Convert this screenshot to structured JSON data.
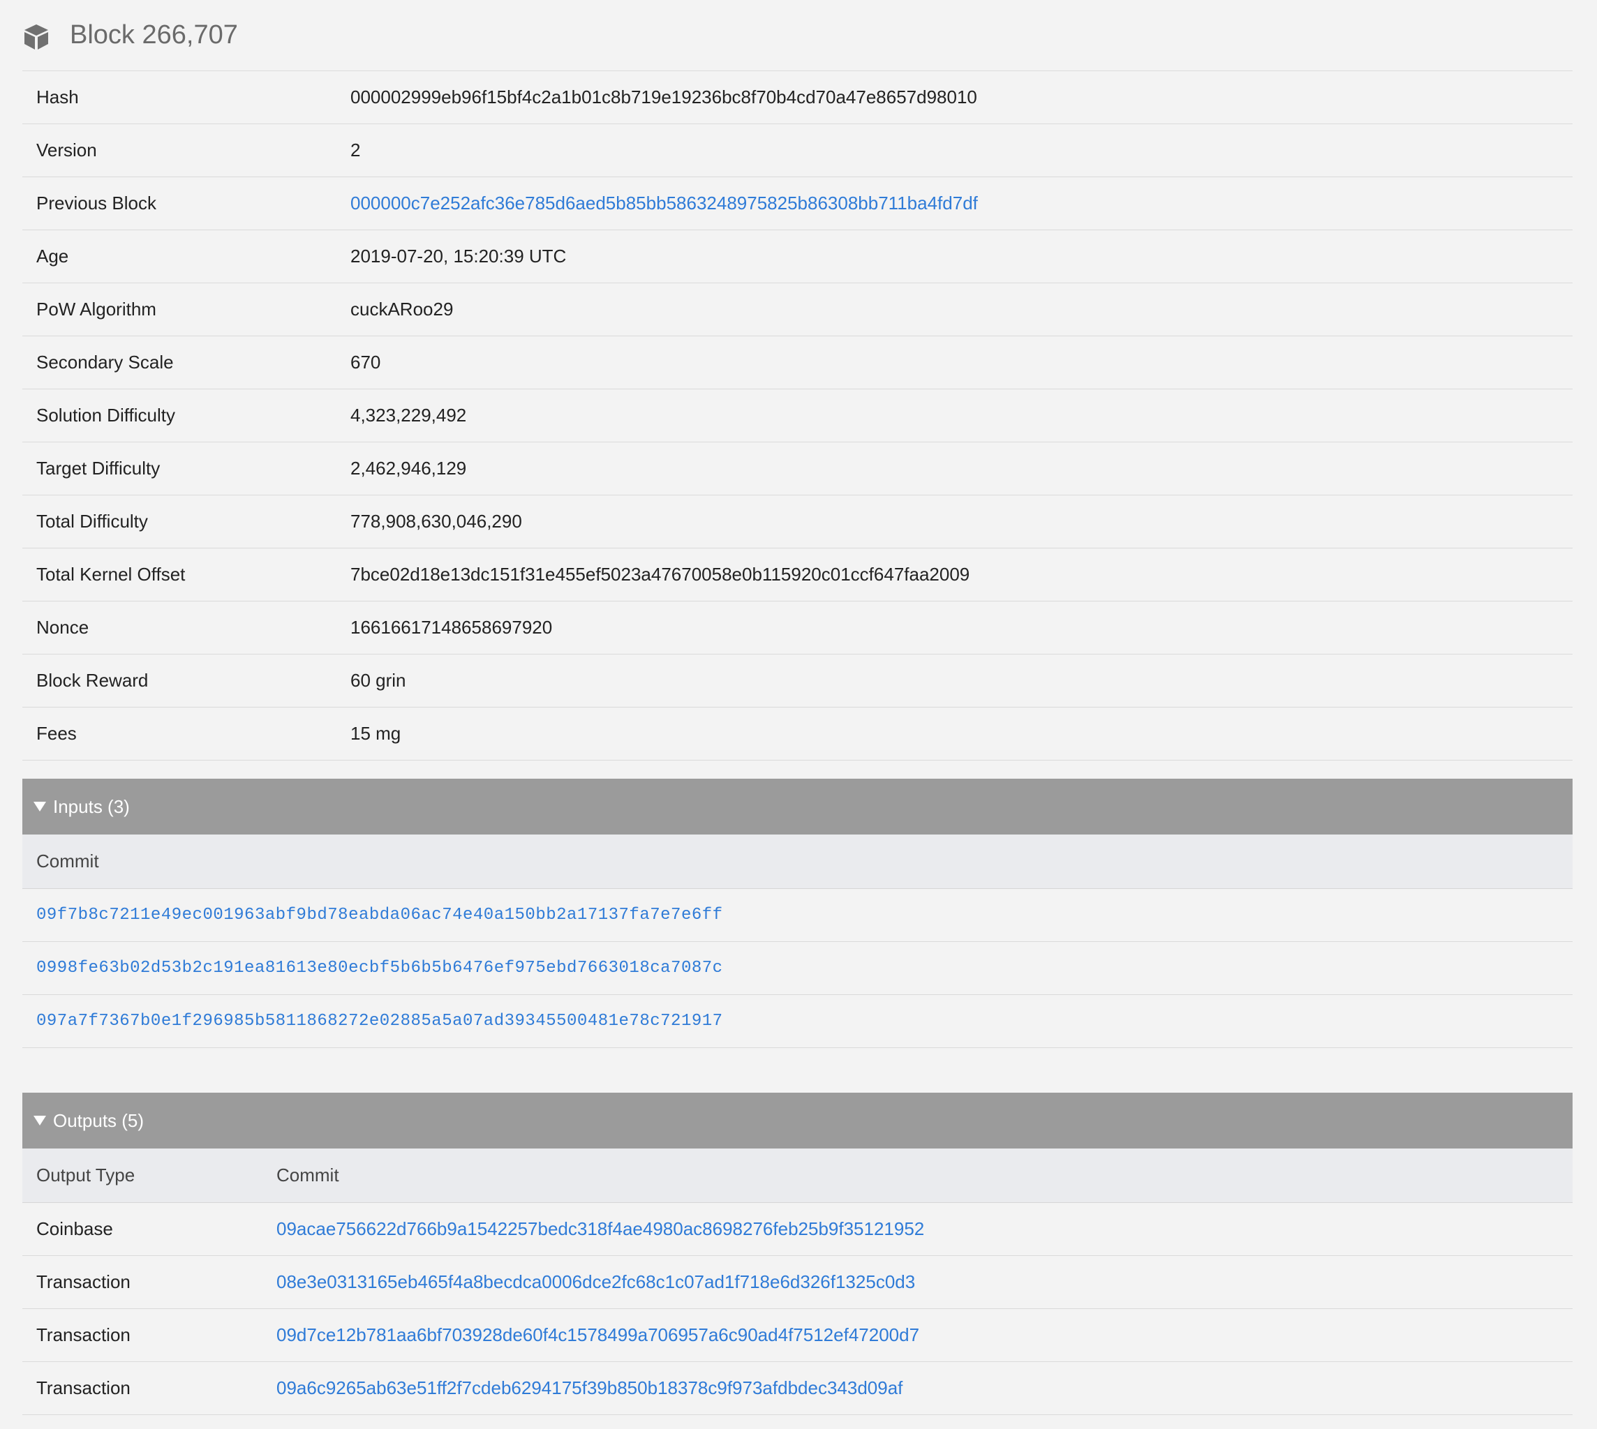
{
  "page": {
    "title": "Block 266,707",
    "title_icon": "cube-icon"
  },
  "details": [
    {
      "label": "Hash",
      "value": "000002999eb96f15bf4c2a1b01c8b719e19236bc8f70b4cd70a47e8657d98010",
      "link": false
    },
    {
      "label": "Version",
      "value": "2",
      "link": false
    },
    {
      "label": "Previous Block",
      "value": "000000c7e252afc36e785d6aed5b85bb5863248975825b86308bb711ba4fd7df",
      "link": true
    },
    {
      "label": "Age",
      "value": "2019-07-20, 15:20:39 UTC",
      "link": false
    },
    {
      "label": "PoW Algorithm",
      "value": "cuckARoo29",
      "link": false
    },
    {
      "label": "Secondary Scale",
      "value": "670",
      "link": false
    },
    {
      "label": "Solution Difficulty",
      "value": "4,323,229,492",
      "link": false
    },
    {
      "label": "Target Difficulty",
      "value": "2,462,946,129",
      "link": false
    },
    {
      "label": "Total Difficulty",
      "value": "778,908,630,046,290",
      "link": false
    },
    {
      "label": "Total Kernel Offset",
      "value": "7bce02d18e13dc151f31e455ef5023a47670058e0b115920c01ccf647faa2009",
      "link": false
    },
    {
      "label": "Nonce",
      "value": "16616617148658697920",
      "link": false
    },
    {
      "label": "Block Reward",
      "value": "60 grin",
      "link": false
    },
    {
      "label": "Fees",
      "value": "15 mg",
      "link": false
    }
  ],
  "inputs": {
    "header": "Inputs (3)",
    "column": "Commit",
    "rows": [
      "09f7b8c7211e49ec001963abf9bd78eabda06ac74e40a150bb2a17137fa7e7e6ff",
      "0998fe63b02d53b2c191ea81613e80ecbf5b6b5b6476ef975ebd7663018ca7087c",
      "097a7f7367b0e1f296985b5811868272e02885a5a07ad39345500481e78c721917"
    ]
  },
  "outputs": {
    "header": "Outputs (5)",
    "columns": {
      "type": "Output Type",
      "commit": "Commit"
    },
    "rows": [
      {
        "type": "Coinbase",
        "commit": "09acae756622d766b9a1542257bedc318f4ae4980ac8698276feb25b9f35121952"
      },
      {
        "type": "Transaction",
        "commit": "08e3e0313165eb465f4a8becdca0006dce2fc68c1c07ad1f718e6d326f1325c0d3"
      },
      {
        "type": "Transaction",
        "commit": "09d7ce12b781aa6bf703928de60f4c1578499a706957a6c90ad4f7512ef47200d7"
      },
      {
        "type": "Transaction",
        "commit": "09a6c9265ab63e51ff2f7cdeb6294175f39b850b18378c9f973afdbdec343d09af"
      }
    ]
  },
  "colors": {
    "link": "#2f7bd7",
    "section_header": "#9b9b9b",
    "column_header": "#eaebee",
    "background": "#f3f3f3"
  }
}
